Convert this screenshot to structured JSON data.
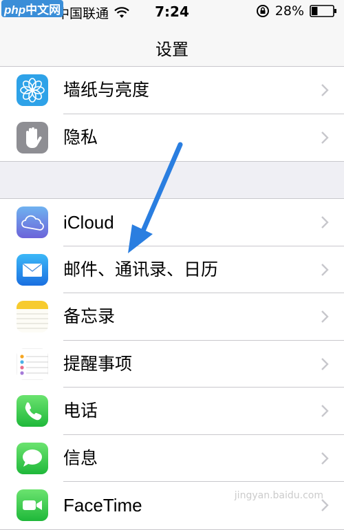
{
  "watermark": {
    "brand_latin": "php",
    "brand_cn": "中文网"
  },
  "status_bar": {
    "carrier": "中国联通",
    "time": "7:24",
    "battery": "28%",
    "battery_level": 0.28
  },
  "nav": {
    "title": "设置"
  },
  "groups": [
    {
      "items": [
        {
          "label": "墙纸与亮度",
          "icon": "wallpaper-flower-icon"
        },
        {
          "label": "隐私",
          "icon": "privacy-hand-icon"
        }
      ]
    },
    {
      "items": [
        {
          "label": "iCloud",
          "icon": "icloud-icon"
        },
        {
          "label": "邮件、通讯录、日历",
          "icon": "mail-icon"
        },
        {
          "label": "备忘录",
          "icon": "notes-icon"
        },
        {
          "label": "提醒事项",
          "icon": "reminders-icon"
        },
        {
          "label": "电话",
          "icon": "phone-icon"
        },
        {
          "label": "信息",
          "icon": "messages-icon"
        },
        {
          "label": "FaceTime",
          "icon": "facetime-icon"
        }
      ]
    }
  ],
  "footer_watermark": "jingyan.baidu.com",
  "colors": {
    "background": "#efeff4",
    "arrow": "#2a7ee0",
    "chevron": "#c7c7cc"
  }
}
